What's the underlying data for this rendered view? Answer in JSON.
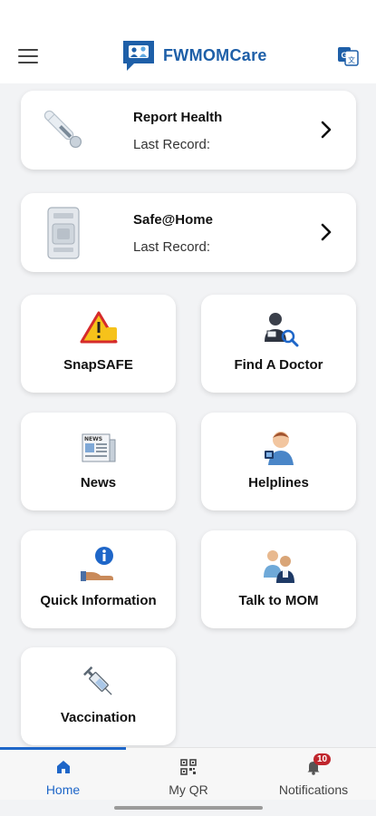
{
  "header": {
    "app_name": "FWMOMCare",
    "brand_color": "#1e5fa8",
    "menu_icon": "hamburger-icon",
    "translate_icon": "translate-icon"
  },
  "cards": [
    {
      "title": "Report Health",
      "subtitle": "Last Record:",
      "icon": "thermometer-icon"
    },
    {
      "title": "Safe@Home",
      "subtitle": "Last Record:",
      "icon": "device-icon"
    }
  ],
  "tiles": [
    {
      "label": "SnapSAFE",
      "icon": "warning-icon"
    },
    {
      "label": "Find A Doctor",
      "icon": "doctor-search-icon"
    },
    {
      "label": "News",
      "icon": "newspaper-icon"
    },
    {
      "label": "Helplines",
      "icon": "helpline-icon"
    },
    {
      "label": "Quick Information",
      "icon": "info-hand-icon"
    },
    {
      "label": "Talk to MOM",
      "icon": "talk-people-icon"
    },
    {
      "label": "Vaccination",
      "icon": "syringe-icon"
    }
  ],
  "tabs": [
    {
      "label": "Home",
      "icon": "home-icon",
      "active": true
    },
    {
      "label": "My QR",
      "icon": "qr-icon"
    },
    {
      "label": "Notifications",
      "icon": "bell-icon",
      "badge": "10"
    }
  ],
  "colors": {
    "accent": "#1e66c8",
    "badge": "#c0262d",
    "background": "#f2f3f5"
  }
}
